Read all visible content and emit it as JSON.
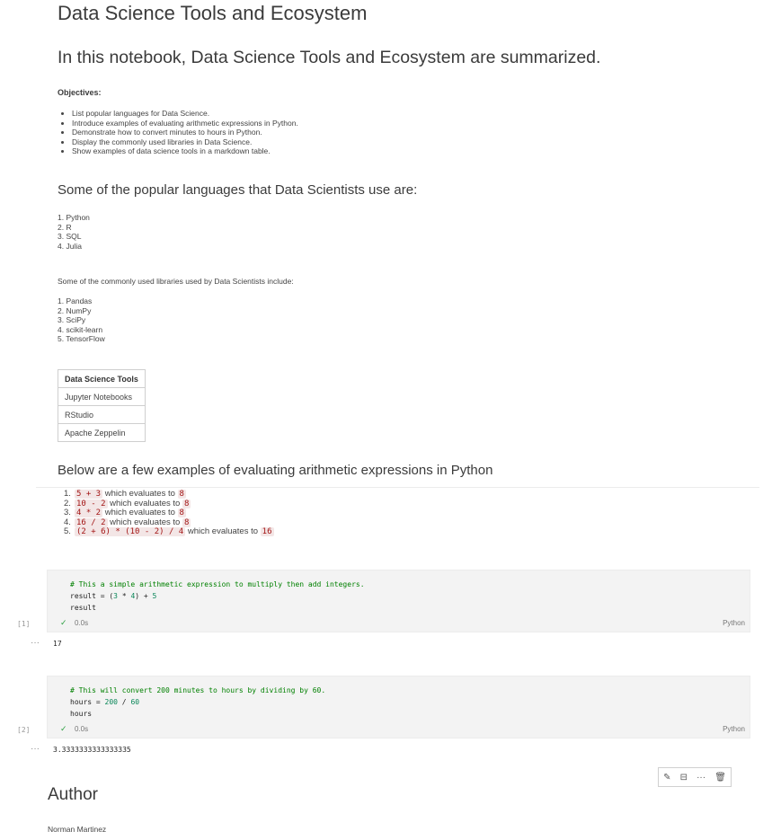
{
  "title": "Data Science Tools and Ecosystem",
  "intro": "In this notebook, Data Science Tools and Ecosystem are summarized.",
  "objectives": {
    "heading": "Objectives:",
    "items": [
      "List popular languages for Data Science.",
      "Introduce examples of evaluating arithmetic expressions in Python.",
      "Demonstrate how to convert minutes to hours in Python.",
      "Display the commonly used libraries in Data Science.",
      "Show examples of data science tools in a markdown table."
    ]
  },
  "languages": {
    "heading": "Some of the popular languages that Data Scientists use are:",
    "items": [
      "1. Python",
      "2. R",
      "3. SQL",
      "4. Julia"
    ]
  },
  "libraries": {
    "heading": "Some of the commonly used libraries used by Data Scientists include:",
    "items": [
      "1. Pandas",
      "2. NumPy",
      "3. SciPy",
      "4. scikit-learn",
      "5. TensorFlow"
    ]
  },
  "tools_table": {
    "header": "Data Science Tools",
    "rows": [
      "Jupyter Notebooks",
      "RStudio",
      "Apache Zeppelin"
    ]
  },
  "arithmetic": {
    "heading": "Below are a few examples of evaluating arithmetic expressions in Python",
    "evaluates_text": "which evaluates to",
    "items": [
      {
        "n": "1.",
        "expr": "5 + 3",
        "result": "8"
      },
      {
        "n": "2.",
        "expr": "10 - 2",
        "result": "8"
      },
      {
        "n": "3.",
        "expr": "4 * 2",
        "result": "8"
      },
      {
        "n": "4.",
        "expr": "16 / 2",
        "result": "8"
      },
      {
        "n": "5.",
        "expr": "(2 + 6) * (10 - 2) / 4",
        "result": "16"
      }
    ]
  },
  "cells": [
    {
      "exec": "[1]",
      "comment": "# This a simple arithmetic expression to multiply then add integers.",
      "line2a": "result = (",
      "line2b": "3",
      "line2c": " * ",
      "line2d": "4",
      "line2e": ") + ",
      "line2f": "5",
      "line3": "result",
      "status": "✓",
      "time": "0.0s",
      "language": "Python",
      "output_dots": "···",
      "output": "17"
    },
    {
      "exec": "[2]",
      "comment": "# This will convert 200 minutes to hours by dividing by 60.",
      "line2a": "hours = ",
      "line2b": "200",
      "line2c": " / ",
      "line2d": "60",
      "line3": "hours",
      "status": "✓",
      "time": "0.0s",
      "language": "Python",
      "output_dots": "···",
      "output": "3.3333333333333335"
    }
  ],
  "toolbar": {
    "edit_icon": "✎",
    "split_icon": "⊟",
    "more_icon": "···",
    "delete_icon": "🗑"
  },
  "author": {
    "heading": "Author",
    "name": "Norman Martinez"
  }
}
